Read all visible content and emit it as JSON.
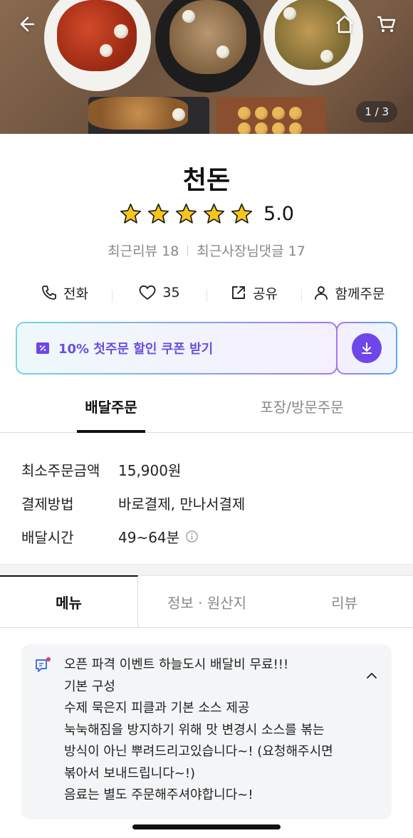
{
  "hero": {
    "page_indicator": "1 / 3"
  },
  "store": {
    "name": "천돈",
    "stars": 5,
    "rating": "5.0",
    "recent_reviews": "최근리뷰 18",
    "owner_replies": "최근사장님댓글 17"
  },
  "actions": {
    "call_label": "전화",
    "like_count": "35",
    "share_label": "공유",
    "group_order_label": "함께주문"
  },
  "coupon": {
    "label": "10% 첫주문 할인 쿠폰 받기"
  },
  "order_tabs": {
    "delivery": "배달주문",
    "pickup": "포장/방문주문"
  },
  "order_info": [
    {
      "key": "최소주문금액",
      "value": "15,900원"
    },
    {
      "key": "결제방법",
      "value": "바로결제, 만나서결제"
    },
    {
      "key": "배달시간",
      "value": "49~64분"
    }
  ],
  "content_tabs": {
    "menu": "메뉴",
    "info": "정보 · 원산지",
    "reviews": "리뷰"
  },
  "notice": {
    "lines": [
      "오픈 파격 이벤트 하늘도시 배달비 무료!!!",
      "기본 구성",
      "수제 묵은지 피클과 기본 소스 제공",
      "눅눅해짐을 방지하기 위해 맛 변경시 소스를 볶는",
      "방식이 아닌 뿌려드리고있습니다~! (요청해주시면",
      "볶아서 보내드립니다~!)",
      "음료는 별도 주문해주셔야합니다~!"
    ]
  },
  "colors": {
    "accent_purple": "#6d47e8",
    "star_yellow": "#f7c51e",
    "text_dark": "#111111",
    "text_gray": "#888888"
  },
  "icons": [
    "back-arrow-icon",
    "home-icon",
    "cart-icon",
    "star-icon",
    "phone-icon",
    "heart-icon",
    "share-icon",
    "person-icon",
    "coupon-icon",
    "download-icon",
    "info-icon",
    "notice-icon",
    "chevron-up-icon"
  ]
}
